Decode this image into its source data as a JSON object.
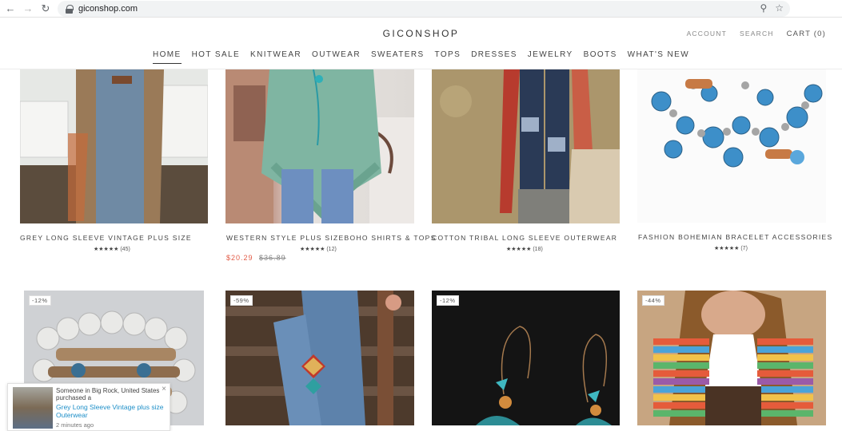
{
  "browser": {
    "url": "giconshop.com"
  },
  "store": {
    "brand": "GICONSHOP",
    "account": "ACCOUNT",
    "search": "SEARCH",
    "cart": "CART (0)"
  },
  "nav": [
    "HOME",
    "HOT SALE",
    "KNITWEAR",
    "OUTWEAR",
    "SWEATERS",
    "TOPS",
    "DRESSES",
    "JEWELRY",
    "BOOTS",
    "WHAT'S NEW"
  ],
  "products": [
    {
      "title": "GREY LONG SLEEVE VINTAGE PLUS SIZE",
      "stars": "★★★★★",
      "reviews": "(45)"
    },
    {
      "title": "WESTERN STYLE PLUS SIZEBOHO SHIRTS & TOPS",
      "stars": "★★★★★",
      "reviews": "(12)",
      "price": "$20.29",
      "old_price": "$36.89"
    },
    {
      "title": "COTTON TRIBAL LONG SLEEVE OUTERWEAR",
      "stars": "★★★★★",
      "reviews": "(18)"
    },
    {
      "title": "FASHION BOHEMIAN BRACELET ACCESSORIES",
      "stars": "★★★★★",
      "reviews": "(7)"
    }
  ],
  "badges": [
    "-12%",
    "-59%",
    "-12%",
    "-44%"
  ],
  "notification": {
    "line1": "Someone in Big Rock, United States purchased a",
    "product": "Grey Long Sleeve Vintage plus size Outerwear",
    "time": "2 minutes ago"
  }
}
